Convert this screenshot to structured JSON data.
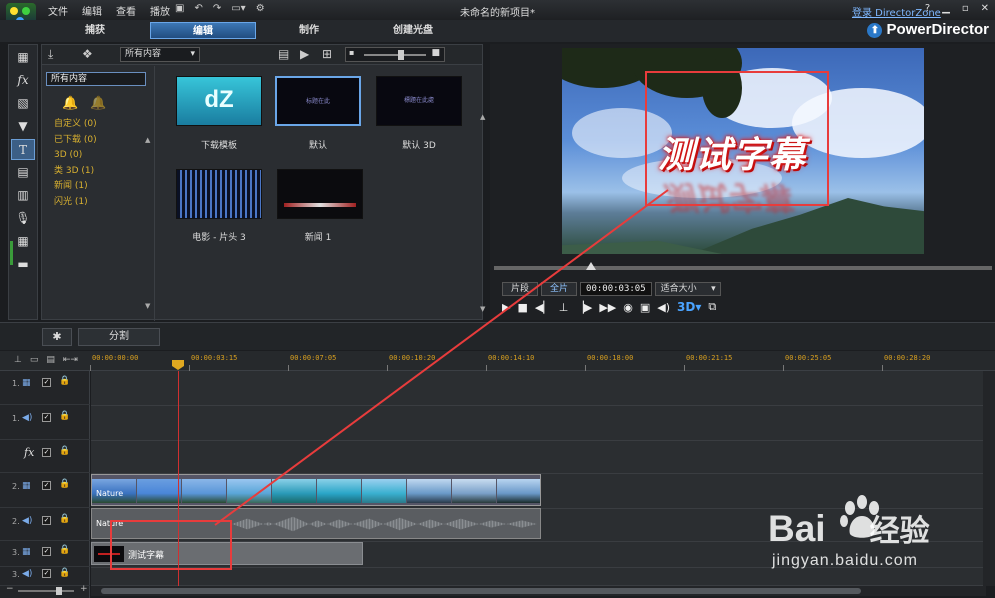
{
  "titlebar": {
    "menu": [
      "文件",
      "编辑",
      "查看",
      "播放"
    ],
    "title": "未命名的新项目*",
    "login": "登录 DirectorZone",
    "brand": "PowerDirector"
  },
  "modes": [
    {
      "label": "捕获",
      "active": false
    },
    {
      "label": "编辑",
      "active": true
    },
    {
      "label": "制作",
      "active": false
    },
    {
      "label": "创建光盘",
      "active": false
    }
  ],
  "left_tools": [
    "film-room-icon",
    "fx-icon",
    "pip-icon",
    "particle-icon",
    "title-icon",
    "transition-icon",
    "audio-mixing-icon",
    "voiceover-icon",
    "chapter-icon",
    "subtitle-icon"
  ],
  "library": {
    "filter": "所有内容",
    "category_field": "所有内容",
    "categories": [
      "自定义  (0)",
      "已下载  (0)",
      "3D  (0)",
      "类 3D  (1)",
      "新闻  (1)",
      "闪光  (1)"
    ],
    "items": [
      {
        "label": "下载模板",
        "thumb_text": "dZ"
      },
      {
        "label": "默认",
        "thumb_text": "标题在此"
      },
      {
        "label": "默认 3D",
        "thumb_text": "標題在此處"
      },
      {
        "label": "电影 - 片头 3",
        "thumb_text": ""
      },
      {
        "label": "新闻 1",
        "thumb_text": ""
      }
    ]
  },
  "preview": {
    "caption": "测试字幕",
    "mode_clip": "片段",
    "mode_movie": "全片",
    "timecode": "00:00:03:05",
    "fit": "适合大小",
    "three_d": "3D"
  },
  "midbar": {
    "split": "分割"
  },
  "ruler": [
    "00:00:00:00",
    "00:00:03:15",
    "00:00:07:05",
    "00:00:10:20",
    "00:00:14:10",
    "00:00:18:00",
    "00:00:21:15",
    "00:00:25:05",
    "00:00:28:20"
  ],
  "tracks": [
    {
      "num": "1.",
      "type": "video"
    },
    {
      "num": "1.",
      "type": "audio"
    },
    {
      "num": "",
      "type": "fx"
    },
    {
      "num": "2.",
      "type": "video"
    },
    {
      "num": "2.",
      "type": "audio"
    },
    {
      "num": "3.",
      "type": "video"
    },
    {
      "num": "3.",
      "type": "audio"
    }
  ],
  "clips": {
    "video_label": "Nature",
    "audio_label": "Nature",
    "title_label": "测试字幕"
  },
  "watermark": {
    "main": "Bai",
    "cn": "经验",
    "url": "jingyan.baidu.com"
  },
  "colors": {
    "accent": "#3d77b5",
    "annotation": "#e83c3c",
    "category_text": "#d8b030",
    "ruler_text": "#d8a020"
  }
}
